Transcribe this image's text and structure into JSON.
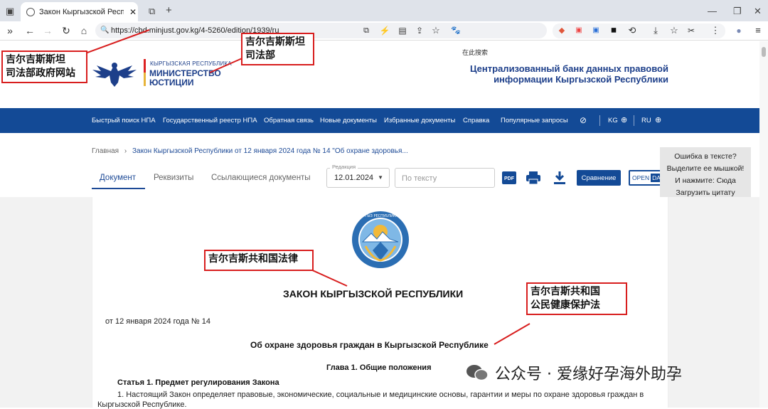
{
  "browser": {
    "tab_title": "Закон Кыргызской Республ",
    "tab_close": "✕",
    "new_tab": "+",
    "url": "https://cbd.minjust.gov.kg/4-5260/edition/1939/ru",
    "search_engine_label": "在此搜索"
  },
  "site": {
    "logo_small": "КЫРГЫЗСКАЯ РЕСПУБЛИКА",
    "logo_big_line1": "МИНИСТЕРСТВО",
    "logo_big_line2": "ЮСТИЦИИ",
    "header_line1": "Централизованный банк данных правовой",
    "header_line2": "информации Кыргызской Республики"
  },
  "nav": {
    "items": [
      "Быстрый поиск НПА",
      "Государственный реестр НПА",
      "Обратная связь",
      "Новые документы",
      "Избранные документы",
      "Справка",
      "Популярные запросы"
    ],
    "lang_kg": "KG",
    "lang_ru": "RU"
  },
  "breadcrumb": {
    "home": "Главная",
    "sep": "›",
    "current": "Закон Кыргызской Республики от 12 января 2024 года № 14 \"Об охране здоровья..."
  },
  "doc_tabs": [
    "Документ",
    "Реквизиты",
    "Ссылающиеся документы"
  ],
  "edition": {
    "label": "Редакция",
    "value": "12.01.2024"
  },
  "search_placeholder": "По тексту",
  "buttons": {
    "compare": "Сравнение",
    "open": "OPEN",
    "data": "DATA",
    "pdf": "PDF"
  },
  "help": {
    "line1": "Ошибка в тексте?",
    "line2": "Выделите ее мышкой!",
    "line3": "И нажмите: Сюда",
    "line4": "Загрузить цитату"
  },
  "document": {
    "emblem_text": "КЫРГЫЗ РЕСПУБЛИКАСЫ",
    "title": "ЗАКОН КЫРГЫЗСКОЙ РЕСПУБЛИКИ",
    "date": "от 12 января 2024 года № 14",
    "subtitle": "Об охране здоровья граждан в Кыргызской Республике",
    "chapter": "Глава 1. Общие положения",
    "article": "Статья 1. Предмет регулирования Закона",
    "para1": "1. Настоящий Закон определяет правовые, экономические, социальные и медицинские основы, гарантии и меры по охране здоровья граждан в",
    "para2": "Кыргызской Республике."
  },
  "annotations": {
    "site_line1": "吉尔吉斯斯坦",
    "site_line2": "司法部政府网站",
    "ministry_line1": "吉尔吉斯斯坦",
    "ministry_line2": "司法部",
    "law": "吉尔吉斯共和国法律",
    "health_line1": "吉尔吉斯共和国",
    "health_line2": "公民健康保护法"
  },
  "watermark": "公众号 · 爱缘好孕海外助孕",
  "colors": {
    "nav_blue": "#134a96",
    "anno_red": "#d81e1e",
    "header_blue": "#1d3f8a"
  }
}
